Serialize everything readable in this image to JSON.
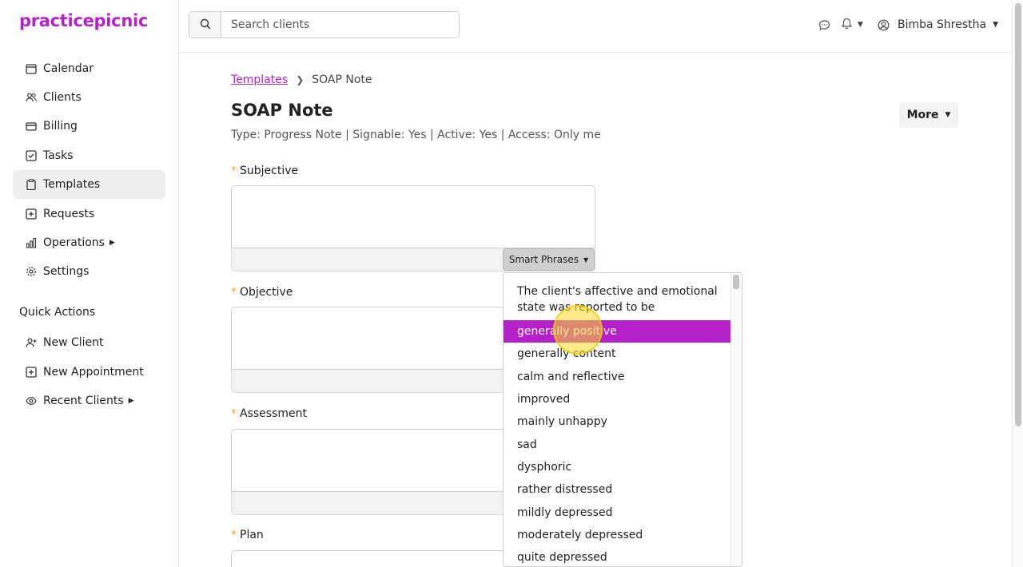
{
  "brand": {
    "name": "practicepicnic",
    "color": "#b620c9"
  },
  "sidebar": {
    "items": [
      {
        "label": "Calendar",
        "icon": "calendar-icon"
      },
      {
        "label": "Clients",
        "icon": "users-icon"
      },
      {
        "label": "Billing",
        "icon": "credit-card-icon"
      },
      {
        "label": "Tasks",
        "icon": "checkbox-icon"
      },
      {
        "label": "Templates",
        "icon": "clipboard-icon",
        "active": true
      },
      {
        "label": "Requests",
        "icon": "plus-square-icon"
      },
      {
        "label": "Operations",
        "icon": "bar-chart-icon",
        "has_submenu": true
      },
      {
        "label": "Settings",
        "icon": "gear-icon"
      }
    ],
    "quick_actions_title": "Quick Actions",
    "quick_actions": [
      {
        "label": "New Client",
        "icon": "user-plus-icon"
      },
      {
        "label": "New Appointment",
        "icon": "calendar-plus-icon"
      },
      {
        "label": "Recent Clients",
        "icon": "eye-icon",
        "has_submenu": true
      }
    ]
  },
  "header": {
    "search_placeholder": "Search clients",
    "user_name": "Bimba Shrestha"
  },
  "breadcrumb": {
    "parent": "Templates",
    "current": "SOAP Note"
  },
  "page": {
    "title": "SOAP Note",
    "meta": "Type: Progress Note | Signable: Yes | Active: Yes | Access: Only me",
    "more_label": "More"
  },
  "fields": [
    {
      "label": "Subjective"
    },
    {
      "label": "Objective"
    },
    {
      "label": "Assessment"
    },
    {
      "label": "Plan"
    }
  ],
  "smart_phrases": {
    "button_label": "Smart Phrases",
    "header": "The client's affective and emotional state was reported to be",
    "options": [
      "generally positive",
      "generally content",
      "calm and reflective",
      "improved",
      "mainly unhappy",
      "sad",
      "dysphoric",
      "rather distressed",
      "mildly depressed",
      "moderately depressed",
      "quite depressed"
    ],
    "highlighted_index": 0
  }
}
